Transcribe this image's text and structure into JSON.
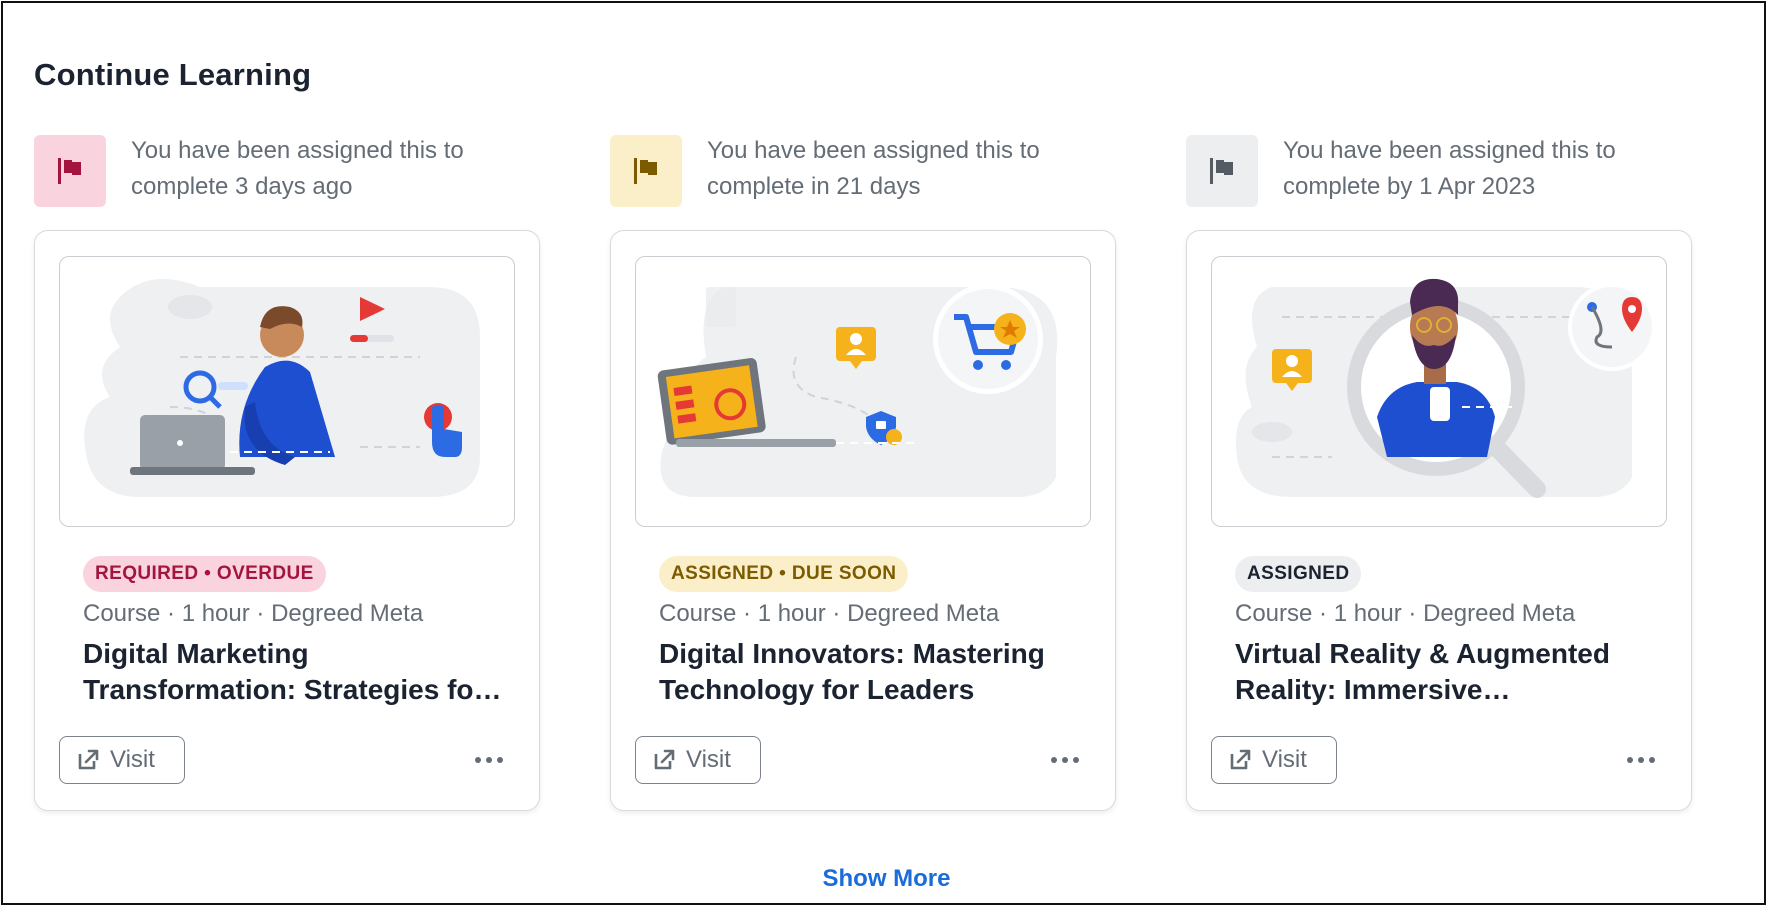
{
  "section": {
    "title": "Continue Learning"
  },
  "cards": [
    {
      "flag_color": "#a3153f",
      "flag_icon": "flag-icon",
      "assigned_text": "You have been assigned this to complete 3 days ago",
      "badge": "REQUIRED • OVERDUE",
      "meta": "Course · 1 hour · Degreed Meta",
      "title": "Digital Marketing Transformation: Strategies for Success",
      "visit_label": "Visit",
      "visit_icon": "external-link-icon",
      "more_icon": "more-options-icon"
    },
    {
      "flag_color": "#9a7300",
      "flag_icon": "flag-icon",
      "assigned_text": "You have been assigned this to complete in 21 days",
      "badge": "ASSIGNED • DUE SOON",
      "meta": "Course · 1 hour · Degreed Meta",
      "title": "Digital Innovators: Mastering Technology for Leaders",
      "visit_label": "Visit",
      "visit_icon": "external-link-icon",
      "more_icon": "more-options-icon"
    },
    {
      "flag_color": "#555b62",
      "flag_icon": "flag-icon",
      "assigned_text": "You have been assigned this to complete by 1 Apr 2023",
      "badge": "ASSIGNED",
      "meta": "Course · 1 hour · Degreed Meta",
      "title": "Virtual Reality & Augmented Reality: Immersive Experiences",
      "visit_label": "Visit",
      "visit_icon": "external-link-icon",
      "more_icon": "more-options-icon"
    }
  ],
  "footer": {
    "show_more": "Show More"
  },
  "colors": {
    "accent_link": "#1a6dd8",
    "overdue": "#a3153f",
    "due_soon": "#7c5a00"
  }
}
